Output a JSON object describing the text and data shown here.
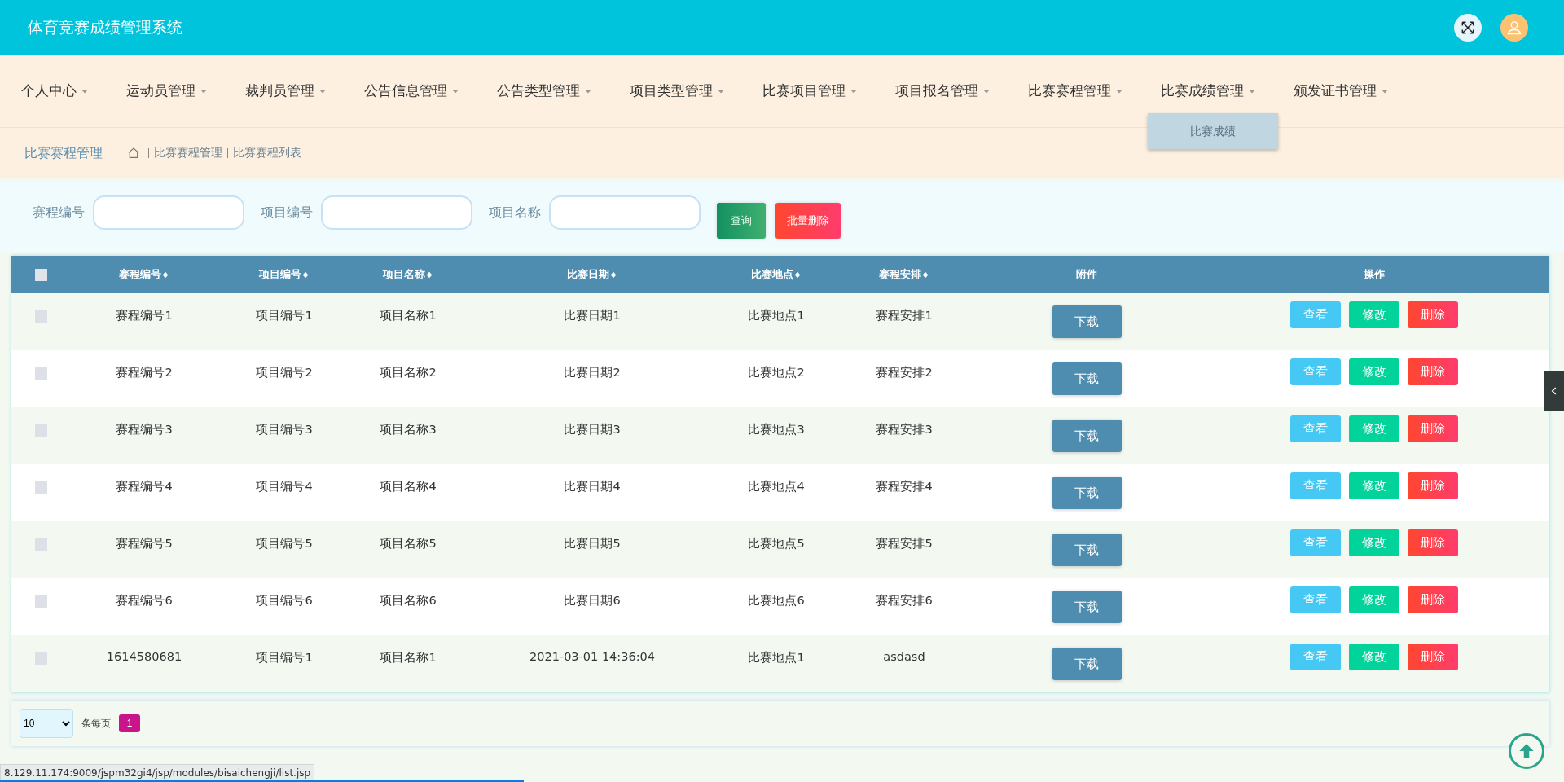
{
  "header": {
    "title": "体育竞赛成绩管理系统"
  },
  "nav": [
    {
      "label": "个人中心"
    },
    {
      "label": "运动员管理"
    },
    {
      "label": "裁判员管理"
    },
    {
      "label": "公告信息管理"
    },
    {
      "label": "公告类型管理"
    },
    {
      "label": "项目类型管理"
    },
    {
      "label": "比赛项目管理"
    },
    {
      "label": "项目报名管理"
    },
    {
      "label": "比赛赛程管理"
    },
    {
      "label": "比赛成绩管理",
      "menu": [
        "比赛成绩"
      ]
    },
    {
      "label": "颁发证书管理"
    }
  ],
  "breadcrumb": {
    "title": "比赛赛程管理",
    "path": [
      "比赛赛程管理",
      "比赛赛程列表"
    ]
  },
  "search": {
    "fields": [
      {
        "label": "赛程编号"
      },
      {
        "label": "项目编号"
      },
      {
        "label": "项目名称"
      }
    ],
    "buttons": [
      {
        "label": "查询",
        "kind": "query"
      },
      {
        "label": "批量删除",
        "kind": "delete"
      }
    ]
  },
  "table": {
    "select_all": {
      "checked": false
    },
    "columns": [
      {
        "label": "赛程编号",
        "sortable": true
      },
      {
        "label": "项目编号",
        "sortable": true
      },
      {
        "label": "项目名称",
        "sortable": true
      },
      {
        "label": "比赛日期",
        "sortable": true
      },
      {
        "label": "比赛地点",
        "sortable": true
      },
      {
        "label": "赛程安排",
        "sortable": true
      },
      {
        "label": "附件",
        "sortable": false
      },
      {
        "label": "操作",
        "sortable": false
      }
    ],
    "rows": [
      {
        "checked": false,
        "cells": [
          "赛程编号1",
          "项目编号1",
          "项目名称1",
          "比赛日期1",
          "比赛地点1",
          "赛程安排1"
        ],
        "download": "下载",
        "actions": [
          "查看",
          "修改",
          "删除"
        ]
      },
      {
        "checked": false,
        "cells": [
          "赛程编号2",
          "项目编号2",
          "项目名称2",
          "比赛日期2",
          "比赛地点2",
          "赛程安排2"
        ],
        "download": "下载",
        "actions": [
          "查看",
          "修改",
          "删除"
        ]
      },
      {
        "checked": false,
        "cells": [
          "赛程编号3",
          "项目编号3",
          "项目名称3",
          "比赛日期3",
          "比赛地点3",
          "赛程安排3"
        ],
        "download": "下载",
        "actions": [
          "查看",
          "修改",
          "删除"
        ]
      },
      {
        "checked": false,
        "cells": [
          "赛程编号4",
          "项目编号4",
          "项目名称4",
          "比赛日期4",
          "比赛地点4",
          "赛程安排4"
        ],
        "download": "下载",
        "actions": [
          "查看",
          "修改",
          "删除"
        ]
      },
      {
        "checked": false,
        "cells": [
          "赛程编号5",
          "项目编号5",
          "项目名称5",
          "比赛日期5",
          "比赛地点5",
          "赛程安排5"
        ],
        "download": "下载",
        "actions": [
          "查看",
          "修改",
          "删除"
        ]
      },
      {
        "checked": false,
        "cells": [
          "赛程编号6",
          "项目编号6",
          "项目名称6",
          "比赛日期6",
          "比赛地点6",
          "赛程安排6"
        ],
        "download": "下载",
        "actions": [
          "查看",
          "修改",
          "删除"
        ]
      },
      {
        "checked": false,
        "cells": [
          "1614580681",
          "项目编号1",
          "项目名称1",
          "2021-03-01 14:36:04",
          "比赛地点1",
          "asdasd"
        ],
        "download": "下载",
        "actions": [
          "查看",
          "修改",
          "删除"
        ]
      }
    ]
  },
  "pagination": {
    "page_size": "10",
    "per_page_label": "条每页",
    "pages": [
      {
        "label": "1",
        "selected": true
      }
    ]
  },
  "status_url": "8.129.11.174:9009/jspm32gi4/jsp/modules/bisaichengji/list.jsp",
  "video_progress": {
    "level": 0.335
  }
}
